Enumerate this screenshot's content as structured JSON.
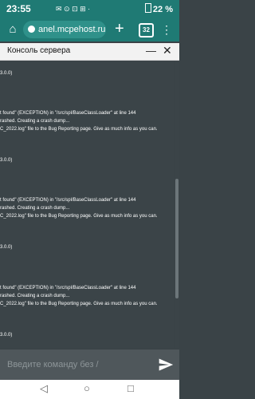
{
  "status_bar": {
    "time": "23:55",
    "icons_text": "✉ ⊙ ⊡ ⊞ ·",
    "battery": "22 %"
  },
  "browser": {
    "url": "anel.mcpehost.ru",
    "tab_count": "32"
  },
  "header": {
    "title": "Консоль сервера"
  },
  "console": {
    "lines": [
      "3.0.0)",
      "t found\" (EXCEPTION) in \"/src/spl/BaseClassLoader\" at line 144",
      "rashed. Creating a crash dump...",
      "C_2022.log\" file to the Bug Reporting page. Give as much info as you can.",
      "3.0.0)",
      "t found\" (EXCEPTION) in \"/src/spl/BaseClassLoader\" at line 144",
      "rashed. Creating a crash dump...",
      "C_2022.log\" file to the Bug Reporting page. Give as much info as you can.",
      "3.0.0)",
      "t found\" (EXCEPTION) in \"/src/spl/BaseClassLoader\" at line 144",
      "rashed. Creating a crash dump...",
      "C_2022.log\" file to the Bug Reporting page. Give as much info as you can.",
      "3.0.0)"
    ]
  },
  "input": {
    "placeholder": "Введите команду без /"
  },
  "colors": {
    "accent": "#1f7a74",
    "console_bg": "#3b4448",
    "input_bg": "#4f575b"
  }
}
